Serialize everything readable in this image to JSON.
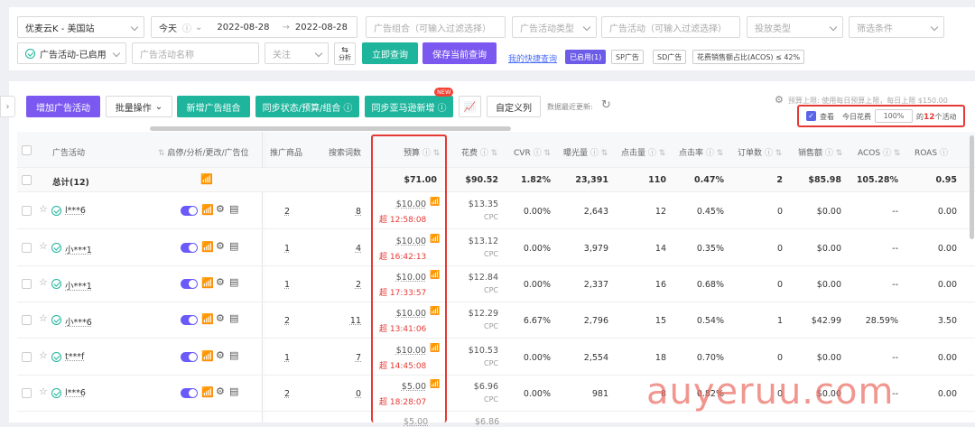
{
  "filters": {
    "site": "优麦云K - 美国站",
    "date_preset": "今天",
    "date_start": "2022-08-28",
    "date_arrow": "→",
    "date_end": "2022-08-28",
    "ad_group_placeholder": "广告组合（可输入过滤选择）",
    "ad_type_placeholder": "广告活动类型",
    "campaign_placeholder": "广告活动（可输入过滤选择）",
    "placement_placeholder": "投放类型",
    "filter_placeholder": "筛选条件",
    "status": "广告活动-已启用",
    "name_placeholder": "广告活动名称",
    "follow": "关注",
    "analyze": "分析",
    "query_btn": "立即查询",
    "save_btn": "保存当前查询",
    "quick_label": "我的快捷查询",
    "quick_tags": [
      "已启用(1)",
      "SP广告",
      "SD广告",
      "花费销售额占比(ACOS) ≤ 42%"
    ]
  },
  "toolbar": {
    "add": "增加广告活动",
    "batch": "批量操作",
    "new_group": "新增广告组合",
    "sync": "同步状态/预算/组合",
    "sync_amazon": "同步亚马逊新增",
    "new_badge": "NEW",
    "custom_cols": "自定义列",
    "last_update": "数据最近更新:",
    "budget_warning": "预算上限: 使用每日预算上限，每日上限 $150.00",
    "view": "查看",
    "today_spend": "今日花费",
    "pct": "100%",
    "suffix_pre": "的",
    "count": "12",
    "suffix_post": "个活动"
  },
  "columns": {
    "campaign": "广告活动",
    "ops": "启停/分析/更改/广告位",
    "products": "推广商品",
    "keywords": "搜索词数",
    "budget": "预算",
    "spend": "花费",
    "cvr": "CVR",
    "impr": "曝光量",
    "clicks": "点击量",
    "ctr": "点击率",
    "orders": "订单数",
    "sales": "销售额",
    "acos": "ACOS",
    "roas": "ROAS"
  },
  "total": {
    "label": "总计(12)",
    "budget": "$71.00",
    "spend": "$90.52",
    "cvr": "1.82%",
    "impr": "23,391",
    "clicks": "110",
    "ctr": "0.47%",
    "orders": "2",
    "sales": "$85.98",
    "acos": "105.28%",
    "roas": "0.95"
  },
  "rows": [
    {
      "name": "l***6",
      "products": "2",
      "keywords": "8",
      "budget": "$10.00",
      "over": "超 12:58:08",
      "spend": "$13.35",
      "spend_type": "CPC",
      "cvr": "0.00%",
      "impr": "2,643",
      "clicks": "12",
      "ctr": "0.45%",
      "orders": "0",
      "sales": "$0.00",
      "acos": "--",
      "roas": "0.00"
    },
    {
      "name": "小***1",
      "products": "1",
      "keywords": "4",
      "budget": "$10.00",
      "over": "超 16:42:13",
      "spend": "$13.12",
      "spend_type": "CPC",
      "cvr": "0.00%",
      "impr": "3,979",
      "clicks": "14",
      "ctr": "0.35%",
      "orders": "0",
      "sales": "$0.00",
      "acos": "--",
      "roas": "0.00"
    },
    {
      "name": "小***1",
      "products": "1",
      "keywords": "2",
      "budget": "$10.00",
      "over": "超 17:33:57",
      "spend": "$12.84",
      "spend_type": "CPC",
      "cvr": "0.00%",
      "impr": "2,337",
      "clicks": "16",
      "ctr": "0.68%",
      "orders": "0",
      "sales": "$0.00",
      "acos": "--",
      "roas": "0.00"
    },
    {
      "name": "小***6",
      "products": "2",
      "keywords": "11",
      "budget": "$10.00",
      "over": "超 13:41:06",
      "spend": "$12.29",
      "spend_type": "CPC",
      "cvr": "6.67%",
      "impr": "2,796",
      "clicks": "15",
      "ctr": "0.54%",
      "orders": "1",
      "sales": "$42.99",
      "acos": "28.59%",
      "roas": "3.50"
    },
    {
      "name": "t***f",
      "products": "1",
      "keywords": "7",
      "budget": "$10.00",
      "over": "超 14:45:08",
      "spend": "$10.53",
      "spend_type": "CPC",
      "cvr": "0.00%",
      "impr": "2,554",
      "clicks": "18",
      "ctr": "0.70%",
      "orders": "0",
      "sales": "$0.00",
      "acos": "--",
      "roas": "0.00"
    },
    {
      "name": "l***6",
      "products": "2",
      "keywords": "0",
      "budget": "$5.00",
      "over": "超 18:28:07",
      "spend": "$6.96",
      "spend_type": "CPC",
      "cvr": "0.00%",
      "impr": "981",
      "clicks": "8",
      "ctr": "0.82%",
      "orders": "0",
      "sales": "$0.00",
      "acos": "--",
      "roas": "0.00"
    }
  ],
  "partial_row": {
    "budget": "$5.00",
    "spend": "$6.86"
  },
  "watermark": "auyeruu.com",
  "colors": {
    "teal": "#1fb59d",
    "purple": "#7b59f0",
    "highlight": "#e53935"
  }
}
